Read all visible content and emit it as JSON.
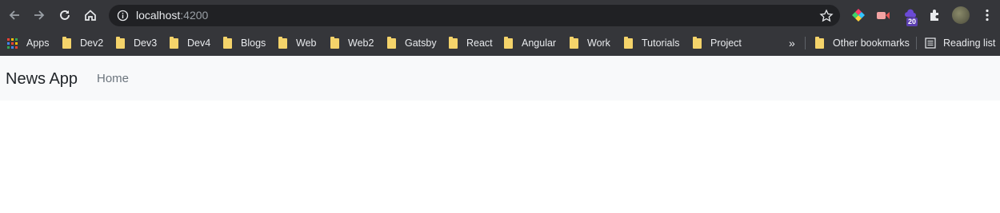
{
  "browser": {
    "url_host": "localhost",
    "url_port": ":4200",
    "extension_badge": "20",
    "bookmarks": [
      {
        "label": "Apps",
        "type": "apps"
      },
      {
        "label": "Dev2",
        "type": "folder"
      },
      {
        "label": "Dev3",
        "type": "folder"
      },
      {
        "label": "Dev4",
        "type": "folder"
      },
      {
        "label": "Blogs",
        "type": "folder"
      },
      {
        "label": "Web",
        "type": "folder"
      },
      {
        "label": "Web2",
        "type": "folder"
      },
      {
        "label": "Gatsby",
        "type": "folder"
      },
      {
        "label": "React",
        "type": "folder"
      },
      {
        "label": "Angular",
        "type": "folder"
      },
      {
        "label": "Work",
        "type": "folder"
      },
      {
        "label": "Tutorials",
        "type": "folder"
      },
      {
        "label": "Project",
        "type": "folder"
      }
    ],
    "overflow_label": "»",
    "other_bookmarks_label": "Other bookmarks",
    "reading_list_label": "Reading list"
  },
  "app": {
    "brand": "News App",
    "nav_links": [
      "Home"
    ]
  },
  "colors": {
    "chrome_bg": "#35363a",
    "omnibox_bg": "#202124",
    "folder": "#f4d36a",
    "navbar_bg": "#f8f9fa",
    "brand_text": "#212529",
    "link_text": "#6c757d"
  }
}
